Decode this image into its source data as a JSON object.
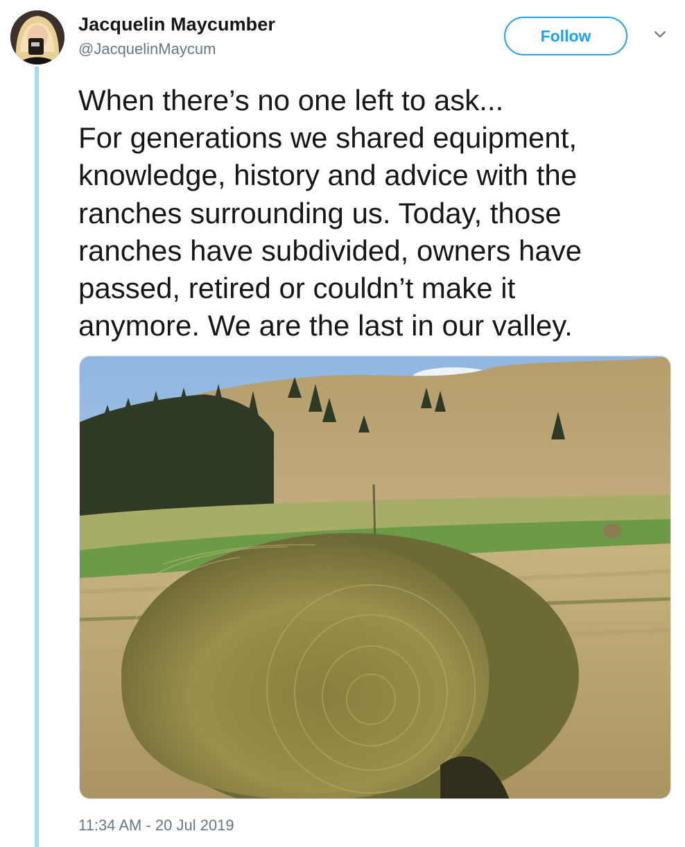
{
  "user": {
    "display_name": "Jacquelin Maycumber",
    "handle": "@JacquelinMaycum"
  },
  "actions": {
    "follow_label": "Follow",
    "more_icon": "chevron-down-icon"
  },
  "tweet": {
    "lines": [
      "When there’s no one left to ask...",
      "For generations we shared equipment,",
      "knowledge, history and advice with the",
      "ranches surrounding us. Today, those",
      "ranches have subdivided, owners have",
      "passed, retired or couldn’t make it",
      "anymore. We are the last in our valley."
    ],
    "timestamp": "11:34 AM - 20 Jul 2019"
  },
  "colors": {
    "accent": "#1da1f2",
    "thread_line": "#a7d9f3",
    "secondary_text": "#657786"
  }
}
